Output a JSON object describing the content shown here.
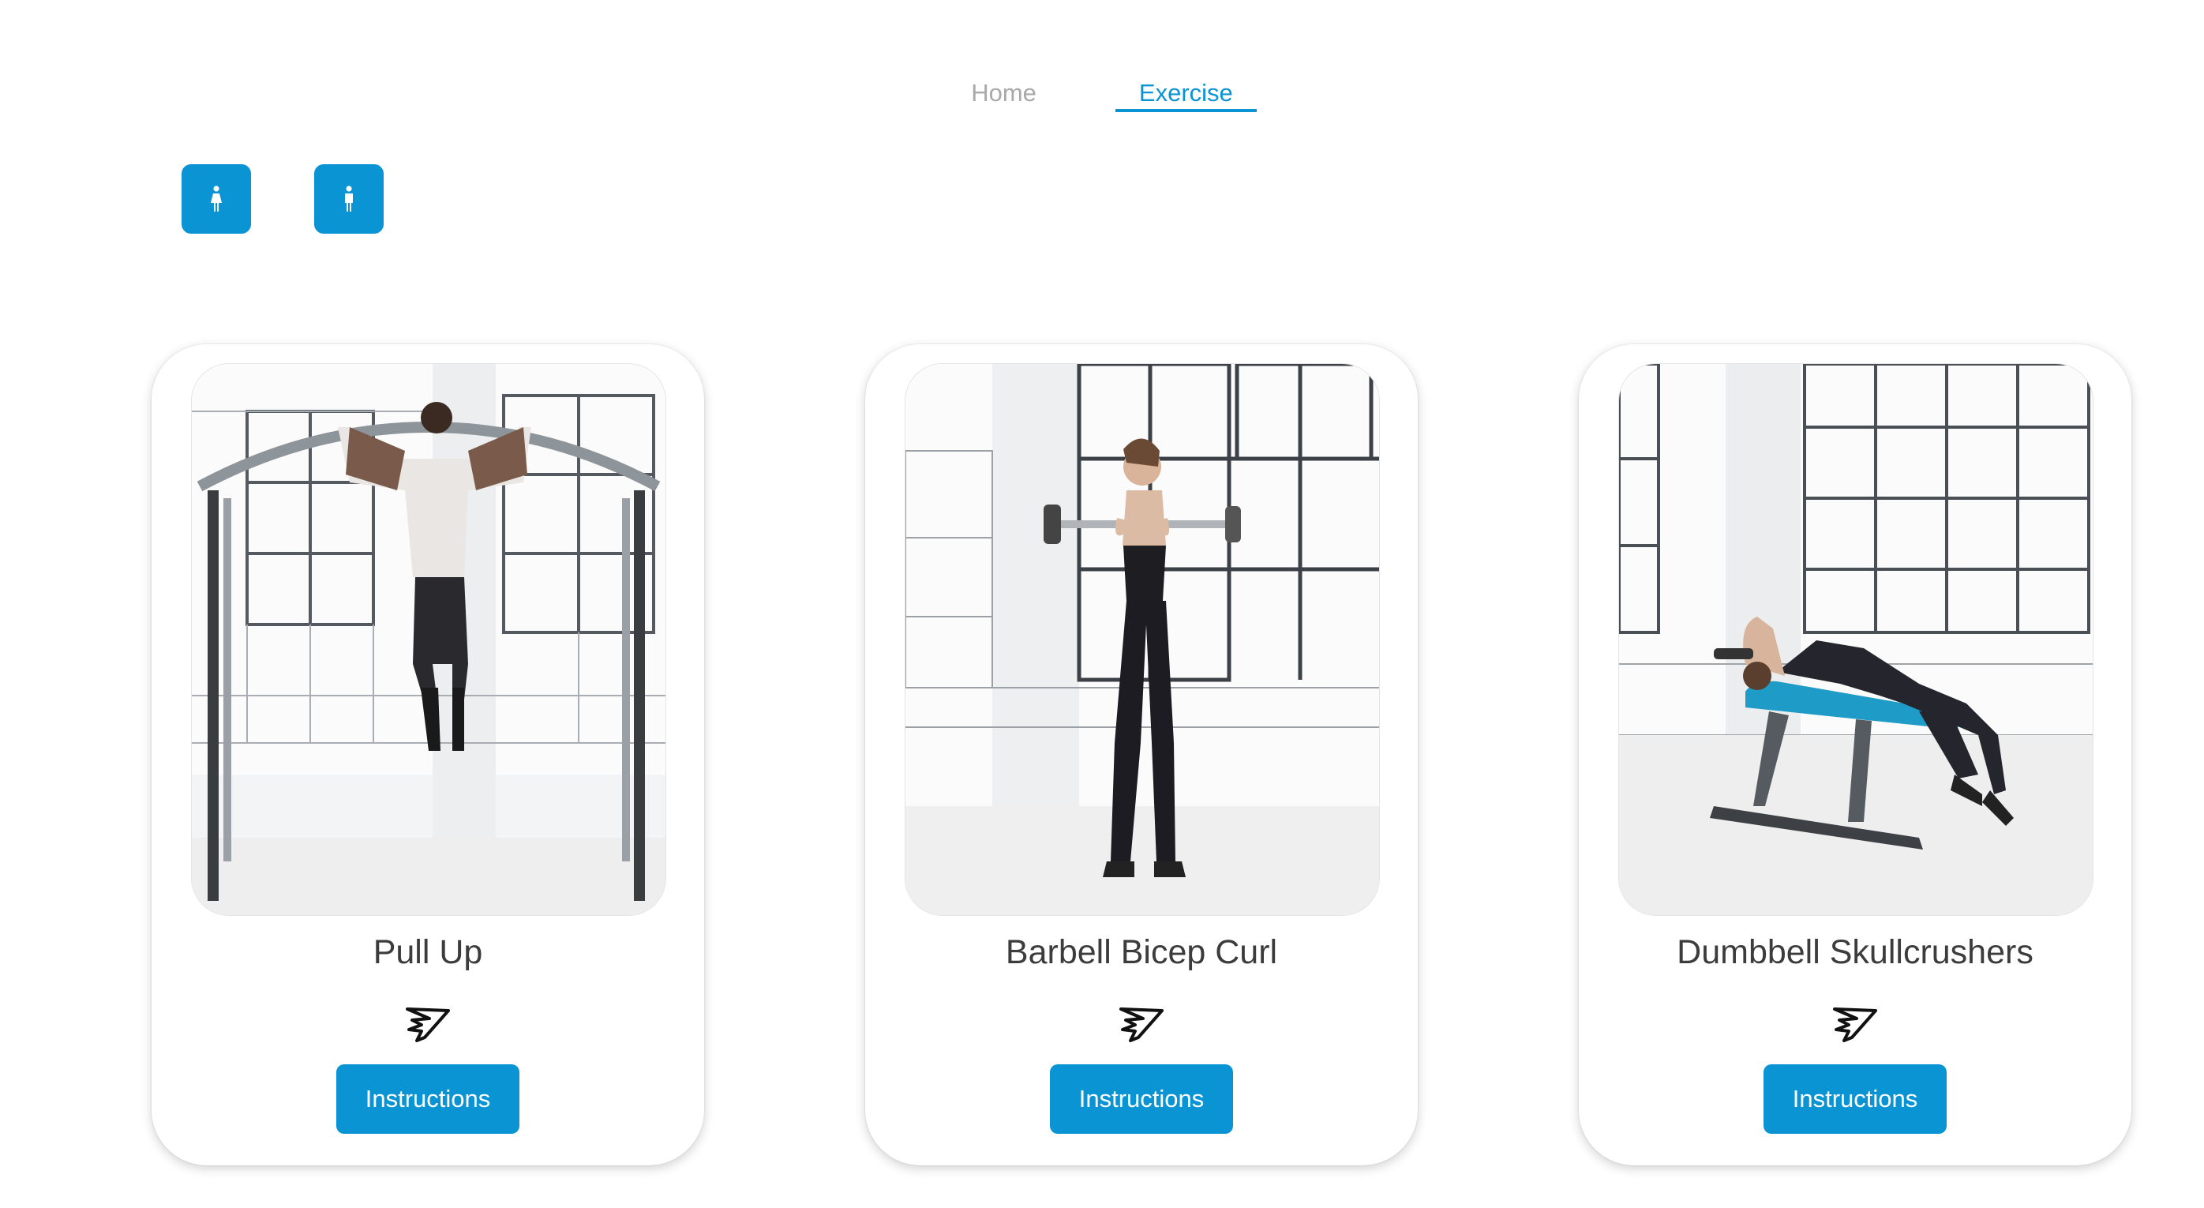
{
  "nav": {
    "items": [
      {
        "label": "Home",
        "active": false
      },
      {
        "label": "Exercise",
        "active": true
      }
    ]
  },
  "gender_filters": [
    {
      "icon": "female-figure-icon"
    },
    {
      "icon": "male-figure-icon"
    }
  ],
  "exercises": [
    {
      "title": "Pull Up",
      "button_label": "Instructions",
      "image": "pull-up-photo",
      "brand": "gymshark-logo-icon"
    },
    {
      "title": "Barbell Bicep Curl",
      "button_label": "Instructions",
      "image": "barbell-bicep-curl-photo",
      "brand": "gymshark-logo-icon"
    },
    {
      "title": "Dumbbell Skullcrushers",
      "button_label": "Instructions",
      "image": "dumbbell-skullcrushers-photo",
      "brand": "gymshark-logo-icon"
    }
  ],
  "colors": {
    "accent": "#0b94d4",
    "nav_inactive": "#a9a9a9",
    "title_text": "#3c3c3c"
  }
}
